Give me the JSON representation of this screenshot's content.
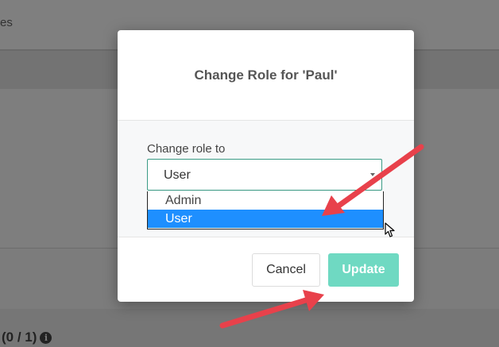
{
  "background": {
    "top_text": "es",
    "bottom_text": "(0 / 1)",
    "bottom_icon": "info-icon"
  },
  "modal": {
    "title": "Change Role for 'Paul'",
    "field_label": "Change role to",
    "select_value": "User",
    "options": [
      {
        "label": "Admin",
        "selected": false
      },
      {
        "label": "User",
        "selected": true
      }
    ],
    "cancel_label": "Cancel",
    "update_label": "Update"
  },
  "colors": {
    "accent": "#3a9b85",
    "update_button": "#6fd9c2",
    "selected_option": "#1e8fff",
    "annotation_arrow": "#e8414b"
  }
}
